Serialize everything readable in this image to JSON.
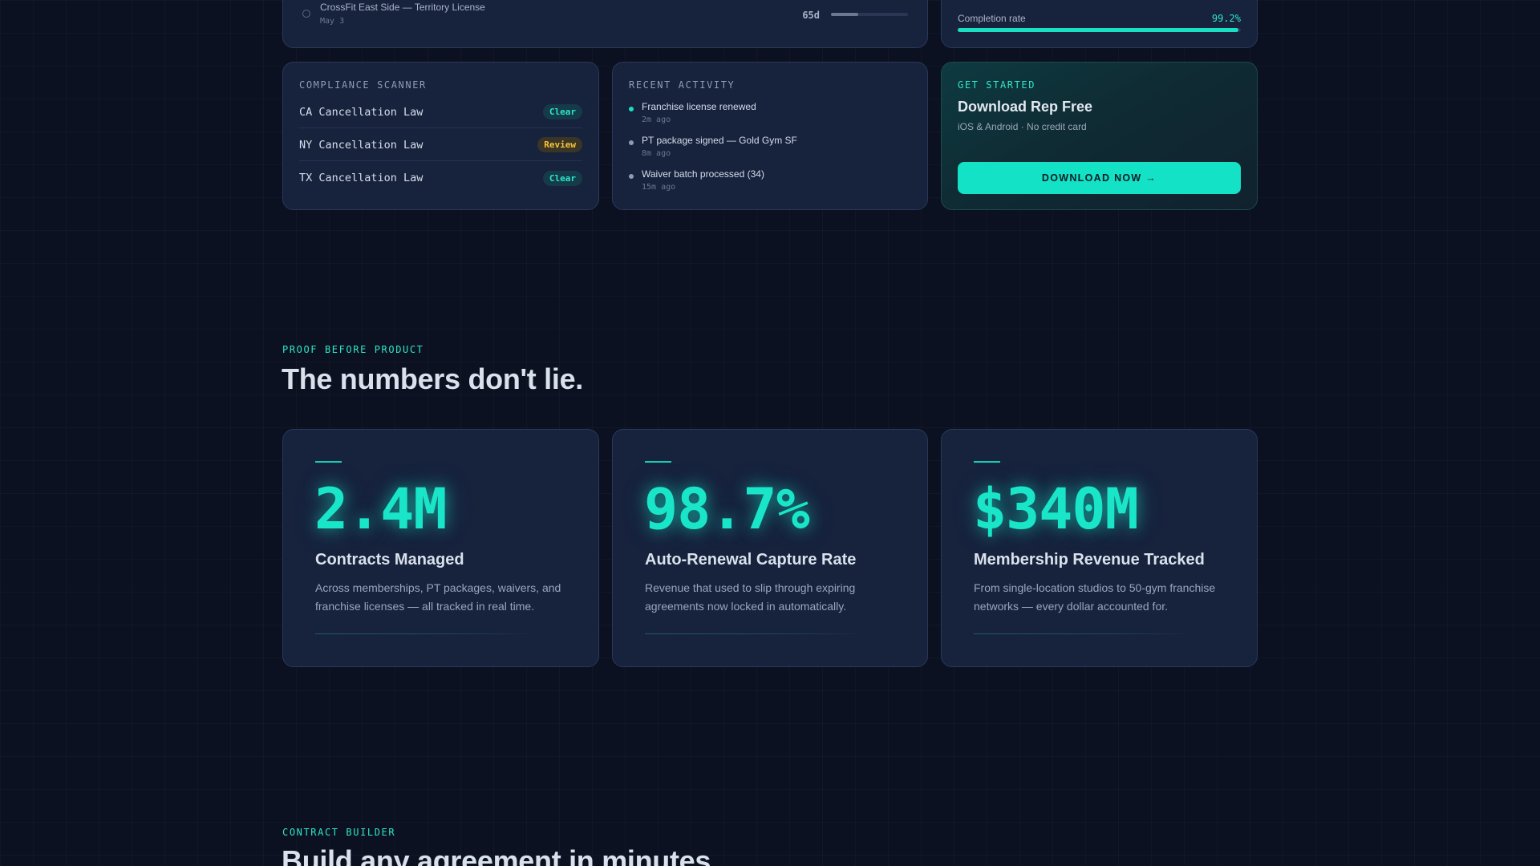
{
  "deadline": {
    "title": "CrossFit East Side — Territory License",
    "date": "May 3",
    "days_left": "65d",
    "progress": 0.35
  },
  "completion": {
    "label": "Completion rate",
    "value": "99.2%",
    "fraction": 0.992
  },
  "compliance": {
    "heading": "COMPLIANCE SCANNER",
    "rows": [
      {
        "label": "CA Cancellation Law",
        "status": "Clear"
      },
      {
        "label": "NY Cancellation Law",
        "status": "Review"
      },
      {
        "label": "TX Cancellation Law",
        "status": "Clear"
      }
    ]
  },
  "activity": {
    "heading": "RECENT ACTIVITY",
    "items": [
      {
        "title": "Franchise license renewed",
        "time": "2m ago"
      },
      {
        "title": "PT package signed — Gold Gym SF",
        "time": "8m ago"
      },
      {
        "title": "Waiver batch processed (34)",
        "time": "15m ago"
      }
    ]
  },
  "get_started": {
    "eyebrow": "GET STARTED",
    "title": "Download Rep Free",
    "subtitle": "iOS & Android · No credit card",
    "button": "DOWNLOAD NOW →"
  },
  "proof": {
    "eyebrow": "PROOF BEFORE PRODUCT",
    "title": "The numbers don't lie."
  },
  "stats": [
    {
      "value": "2.4M",
      "label": "Contracts Managed",
      "desc": "Across memberships, PT packages, waivers, and franchise licenses — all tracked in real time."
    },
    {
      "value": "98.7%",
      "label": "Auto-Renewal Capture Rate",
      "desc": "Revenue that used to slip through expiring agreements now locked in automatically."
    },
    {
      "value": "$340M",
      "label": "Membership Revenue Tracked",
      "desc": "From single-location studios to 50-gym franchise networks — every dollar accounted for."
    }
  ],
  "builder": {
    "eyebrow": "CONTRACT BUILDER",
    "title": "Build any agreement in minutes."
  },
  "colors": {
    "accent": "#19e0c3",
    "background": "#0b1120",
    "card": "#17223d",
    "review": "#f5c23d"
  }
}
